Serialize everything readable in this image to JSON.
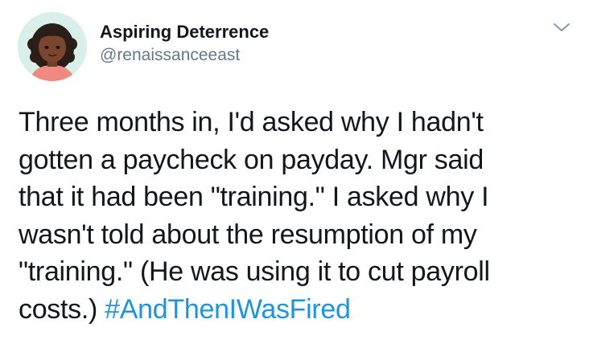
{
  "tweet": {
    "author": {
      "display_name": "Aspiring Deterrence",
      "handle": "@renaissanceeast",
      "avatar": "cartoon-woman-avatar"
    },
    "menu_icon": "chevron-down-icon",
    "lines": [
      "Three months in, I'd asked why I hadn't",
      "gotten a paycheck on payday. Mgr said",
      "that it had been \"training.\" I asked why I",
      "wasn't told about the resumption of my",
      "\"training.\" (He was using it to cut payroll"
    ],
    "last_line_text": "costs.) ",
    "hashtag": "#AndThenIWasFired"
  },
  "colors": {
    "text": "#14171a",
    "secondary": "#657786",
    "link": "#1b95e0",
    "avatar_bg": "#d9efe9"
  }
}
